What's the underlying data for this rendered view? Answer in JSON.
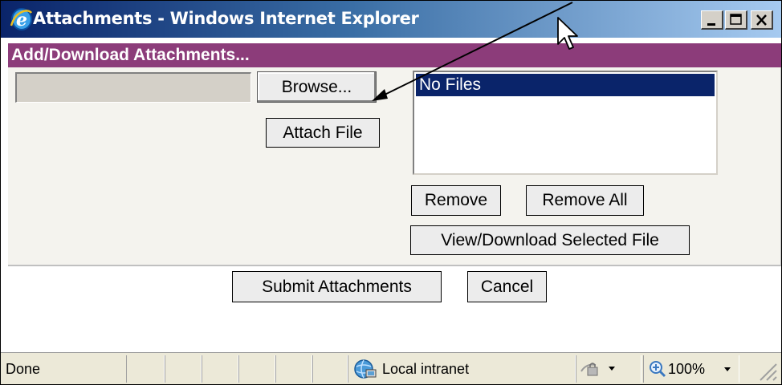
{
  "window": {
    "title": "Attachments - Windows Internet Explorer",
    "controls": [
      "minimize-icon",
      "maximize-icon",
      "close-icon"
    ]
  },
  "dialog": {
    "header": "Add/Download Attachments...",
    "file_input_value": "",
    "browse_label": "Browse...",
    "attach_label": "Attach File",
    "files_list": {
      "items": [
        "No Files"
      ],
      "selected_index": 0
    },
    "remove_label": "Remove",
    "remove_all_label": "Remove All",
    "view_download_label": "View/Download Selected File",
    "submit_label": "Submit Attachments",
    "cancel_label": "Cancel"
  },
  "statusbar": {
    "status_text": "Done",
    "zone_text": "Local intranet",
    "zoom_text": "100%"
  },
  "colors": {
    "titlebar_start": "#0a246a",
    "titlebar_end": "#a6caf0",
    "header_bg": "#8c3c7a",
    "selection_bg": "#0a246a"
  }
}
